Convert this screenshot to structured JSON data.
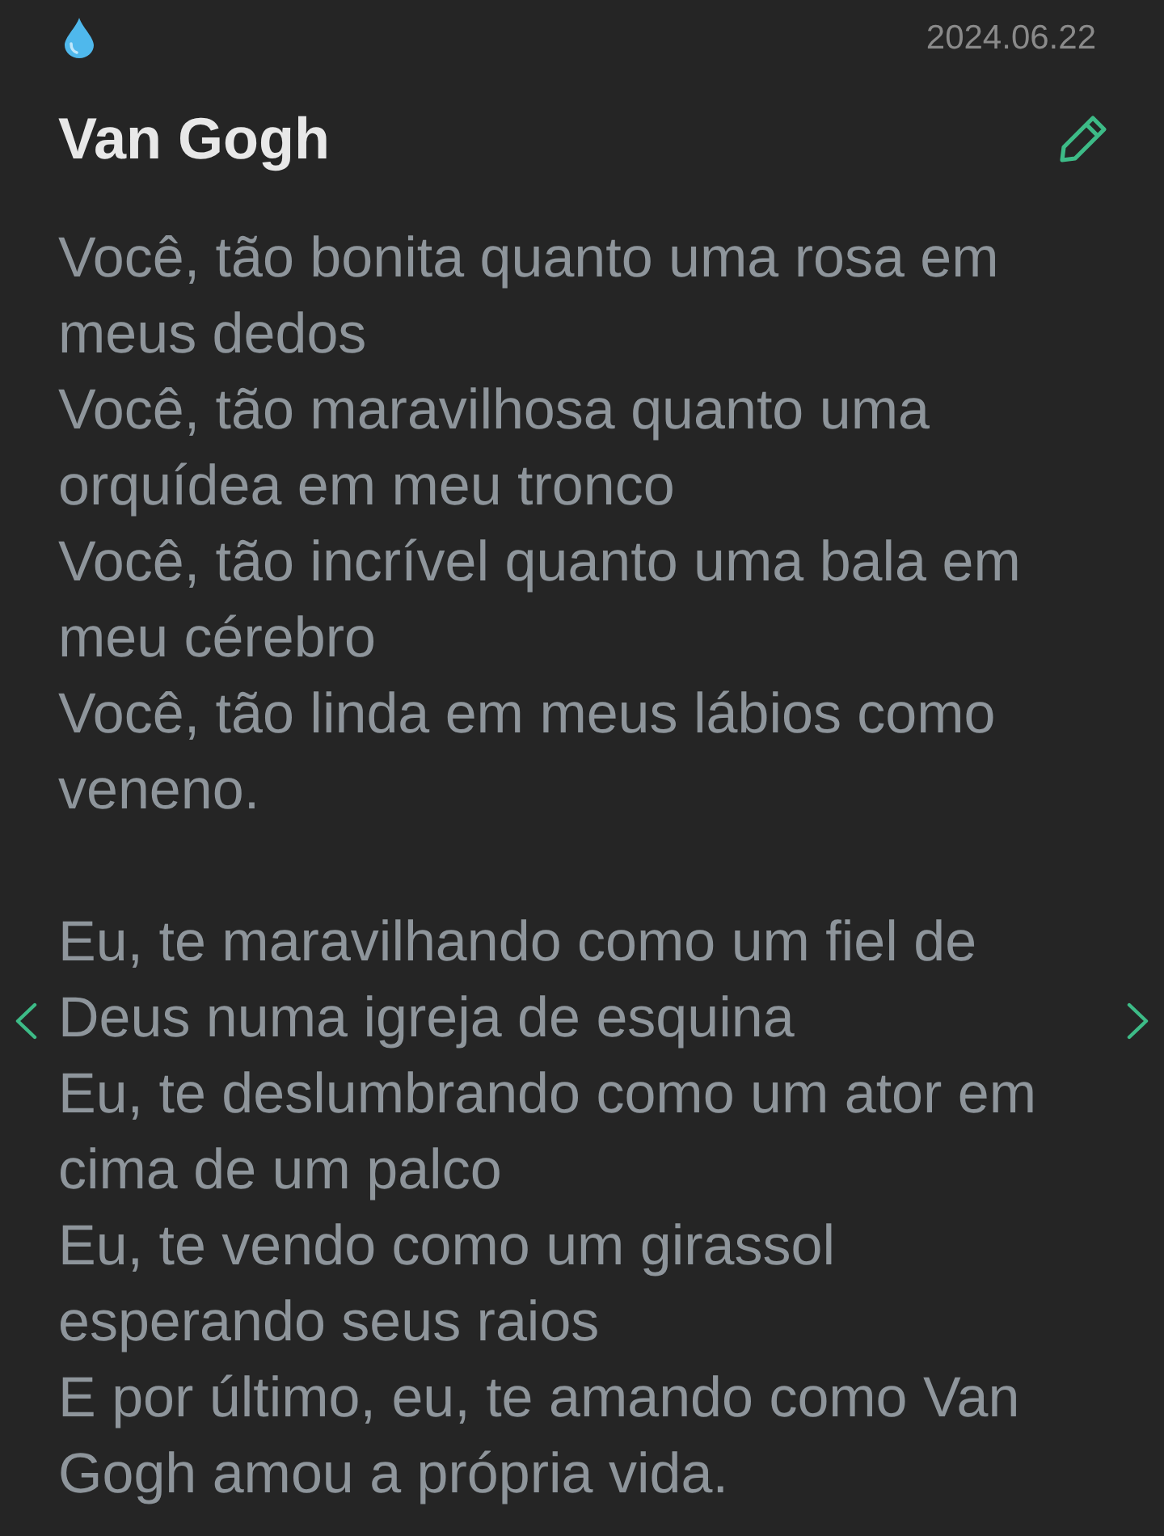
{
  "header": {
    "date": "2024.06.22"
  },
  "note": {
    "title": "Van Gogh",
    "stanzas": [
      [
        "Você, tão bonita quanto uma rosa em meus dedos",
        "Você, tão maravilhosa quanto uma orquídea em meu tronco",
        "Você, tão incrível quanto uma bala em meu cérebro",
        "Você, tão linda em meus lábios como veneno."
      ],
      [
        "Eu, te maravilhando como um fiel de Deus numa igreja de esquina",
        "Eu, te deslumbrando como um ator em cima de um palco",
        "Eu, te vendo como um girassol esperando seus raios",
        "E por último, eu, te amando como Van Gogh amou a própria vida."
      ]
    ]
  }
}
